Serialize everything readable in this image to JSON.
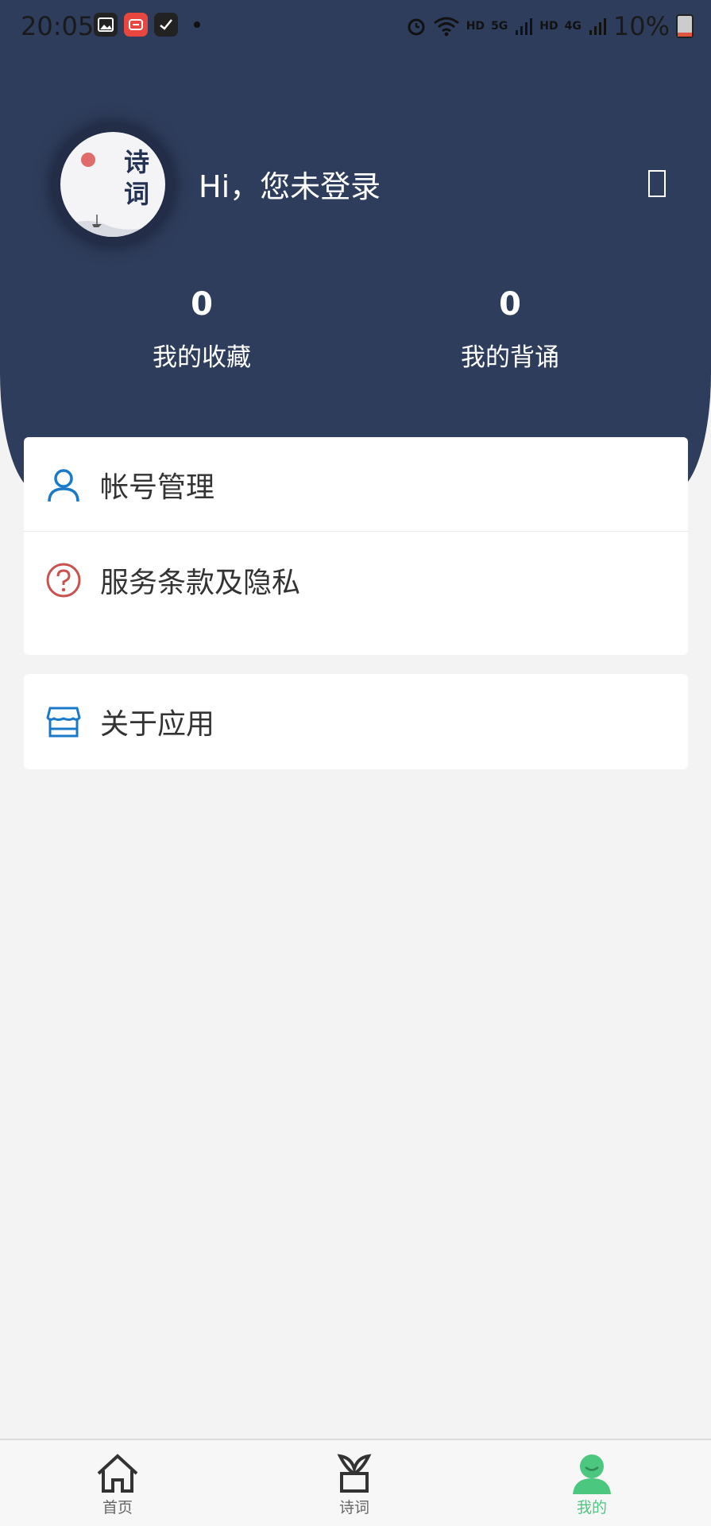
{
  "status_bar": {
    "time": "20:05",
    "left_icons": [
      "gallery-icon",
      "taobao-icon",
      "app-icon"
    ],
    "signal_labels": [
      "HD",
      "5G",
      "HD",
      "4G"
    ],
    "battery": "10%"
  },
  "profile": {
    "avatar_text": "诗词",
    "greeting": "Hi，您未登录",
    "more_icon": "more-icon"
  },
  "stats": [
    {
      "value": "0",
      "label": "我的收藏"
    },
    {
      "value": "0",
      "label": "我的背诵"
    }
  ],
  "menu": {
    "group1": [
      {
        "label": "帐号管理",
        "icon": "user-icon",
        "color": "#1a7ac9"
      },
      {
        "label": "服务条款及隐私",
        "icon": "help-circle-icon",
        "color": "#c9524f"
      }
    ],
    "group2": [
      {
        "label": "关于应用",
        "icon": "store-icon",
        "color": "#1a7ac9"
      }
    ]
  },
  "tabbar": {
    "items": [
      {
        "label": "首页",
        "icon": "home-icon",
        "active": false
      },
      {
        "label": "诗词",
        "icon": "plant-icon",
        "active": false
      },
      {
        "label": "我的",
        "icon": "person-icon",
        "active": true
      }
    ],
    "active_color": "#4cc780"
  },
  "colors": {
    "header": "#2f3d5c",
    "background": "#f3f3f3"
  }
}
